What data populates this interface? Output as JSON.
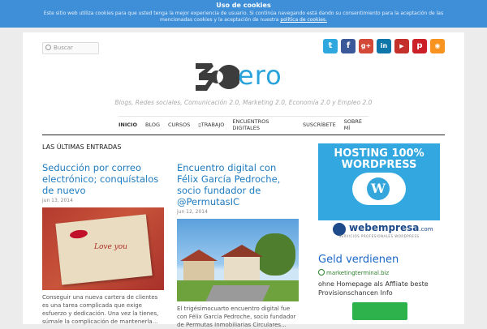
{
  "cookie_bar": {
    "title": "Uso de cookies",
    "message": "Este sitio web utiliza cookies para que usted tenga la mejor experiencia de usuario. Si continúa navegando está dando su consentimiento para la aceptación de las mencionadas cookies y la aceptación de nuestra",
    "link": "política de cookies."
  },
  "search": {
    "placeholder": "Buscar"
  },
  "social": [
    {
      "name": "twitter-icon",
      "glyph": "t",
      "color": "#2fa8e0"
    },
    {
      "name": "facebook-icon",
      "glyph": "f",
      "color": "#3b5998"
    },
    {
      "name": "google-plus-icon",
      "glyph": "g+",
      "color": "#d34836"
    },
    {
      "name": "linkedin-icon",
      "glyph": "in",
      "color": "#0e76a8"
    },
    {
      "name": "youtube-icon",
      "glyph": "▶",
      "color": "#c4302b"
    },
    {
      "name": "pinterest-icon",
      "glyph": "p",
      "color": "#cb2027"
    },
    {
      "name": "rss-icon",
      "glyph": "◉",
      "color": "#f7931e"
    }
  ],
  "logo": {
    "text": "ero"
  },
  "tagline": "Blogs, Redes sociales, Comunicación 2.0, Marketing 2.0, Economía 2.0 y Empleo 2.0",
  "nav": [
    "INICIO",
    "BLOG",
    "CURSOS",
    "TRABAJO",
    "ENCUENTROS DIGITALES",
    "SUSCRÍBETE",
    "SOBRE MÍ"
  ],
  "section_title": "LAS ÚLTIMAS ENTRADAS",
  "posts": [
    {
      "title": "Seducción por correo electrónico; conquístalos de nuevo",
      "date": "jun 13, 2014",
      "image_text": "Love you",
      "excerpt": "Conseguir una nueva cartera de clientes es una tarea complicada que exige esfuerzo y dedicación. Una vez la tienes, súmale la complicación de mantenerla..."
    },
    {
      "title": "Encuentro digital con Félix García Pedroche, socio fundador de @PermutasIC",
      "date": "jun 12, 2014",
      "excerpt": "El trigésimocuarto encuentro digital fue con Félix García Pedroche, socio fundador de Permutas Inmobiliarias Circulares..."
    }
  ],
  "sidebar": {
    "ad_headline": "HOSTING 100% WORDPRESS",
    "ad_brand": "webempresa",
    "ad_brand_suffix": ".com",
    "ad_sub": "SERVICIOS PROFESIONALES WORDPRESS",
    "text_ad_title": "Geld verdienen",
    "text_ad_url": "marketingterminal.biz",
    "text_ad_body": "ohne Homepage als Affliate beste Provisionschancen Info"
  }
}
